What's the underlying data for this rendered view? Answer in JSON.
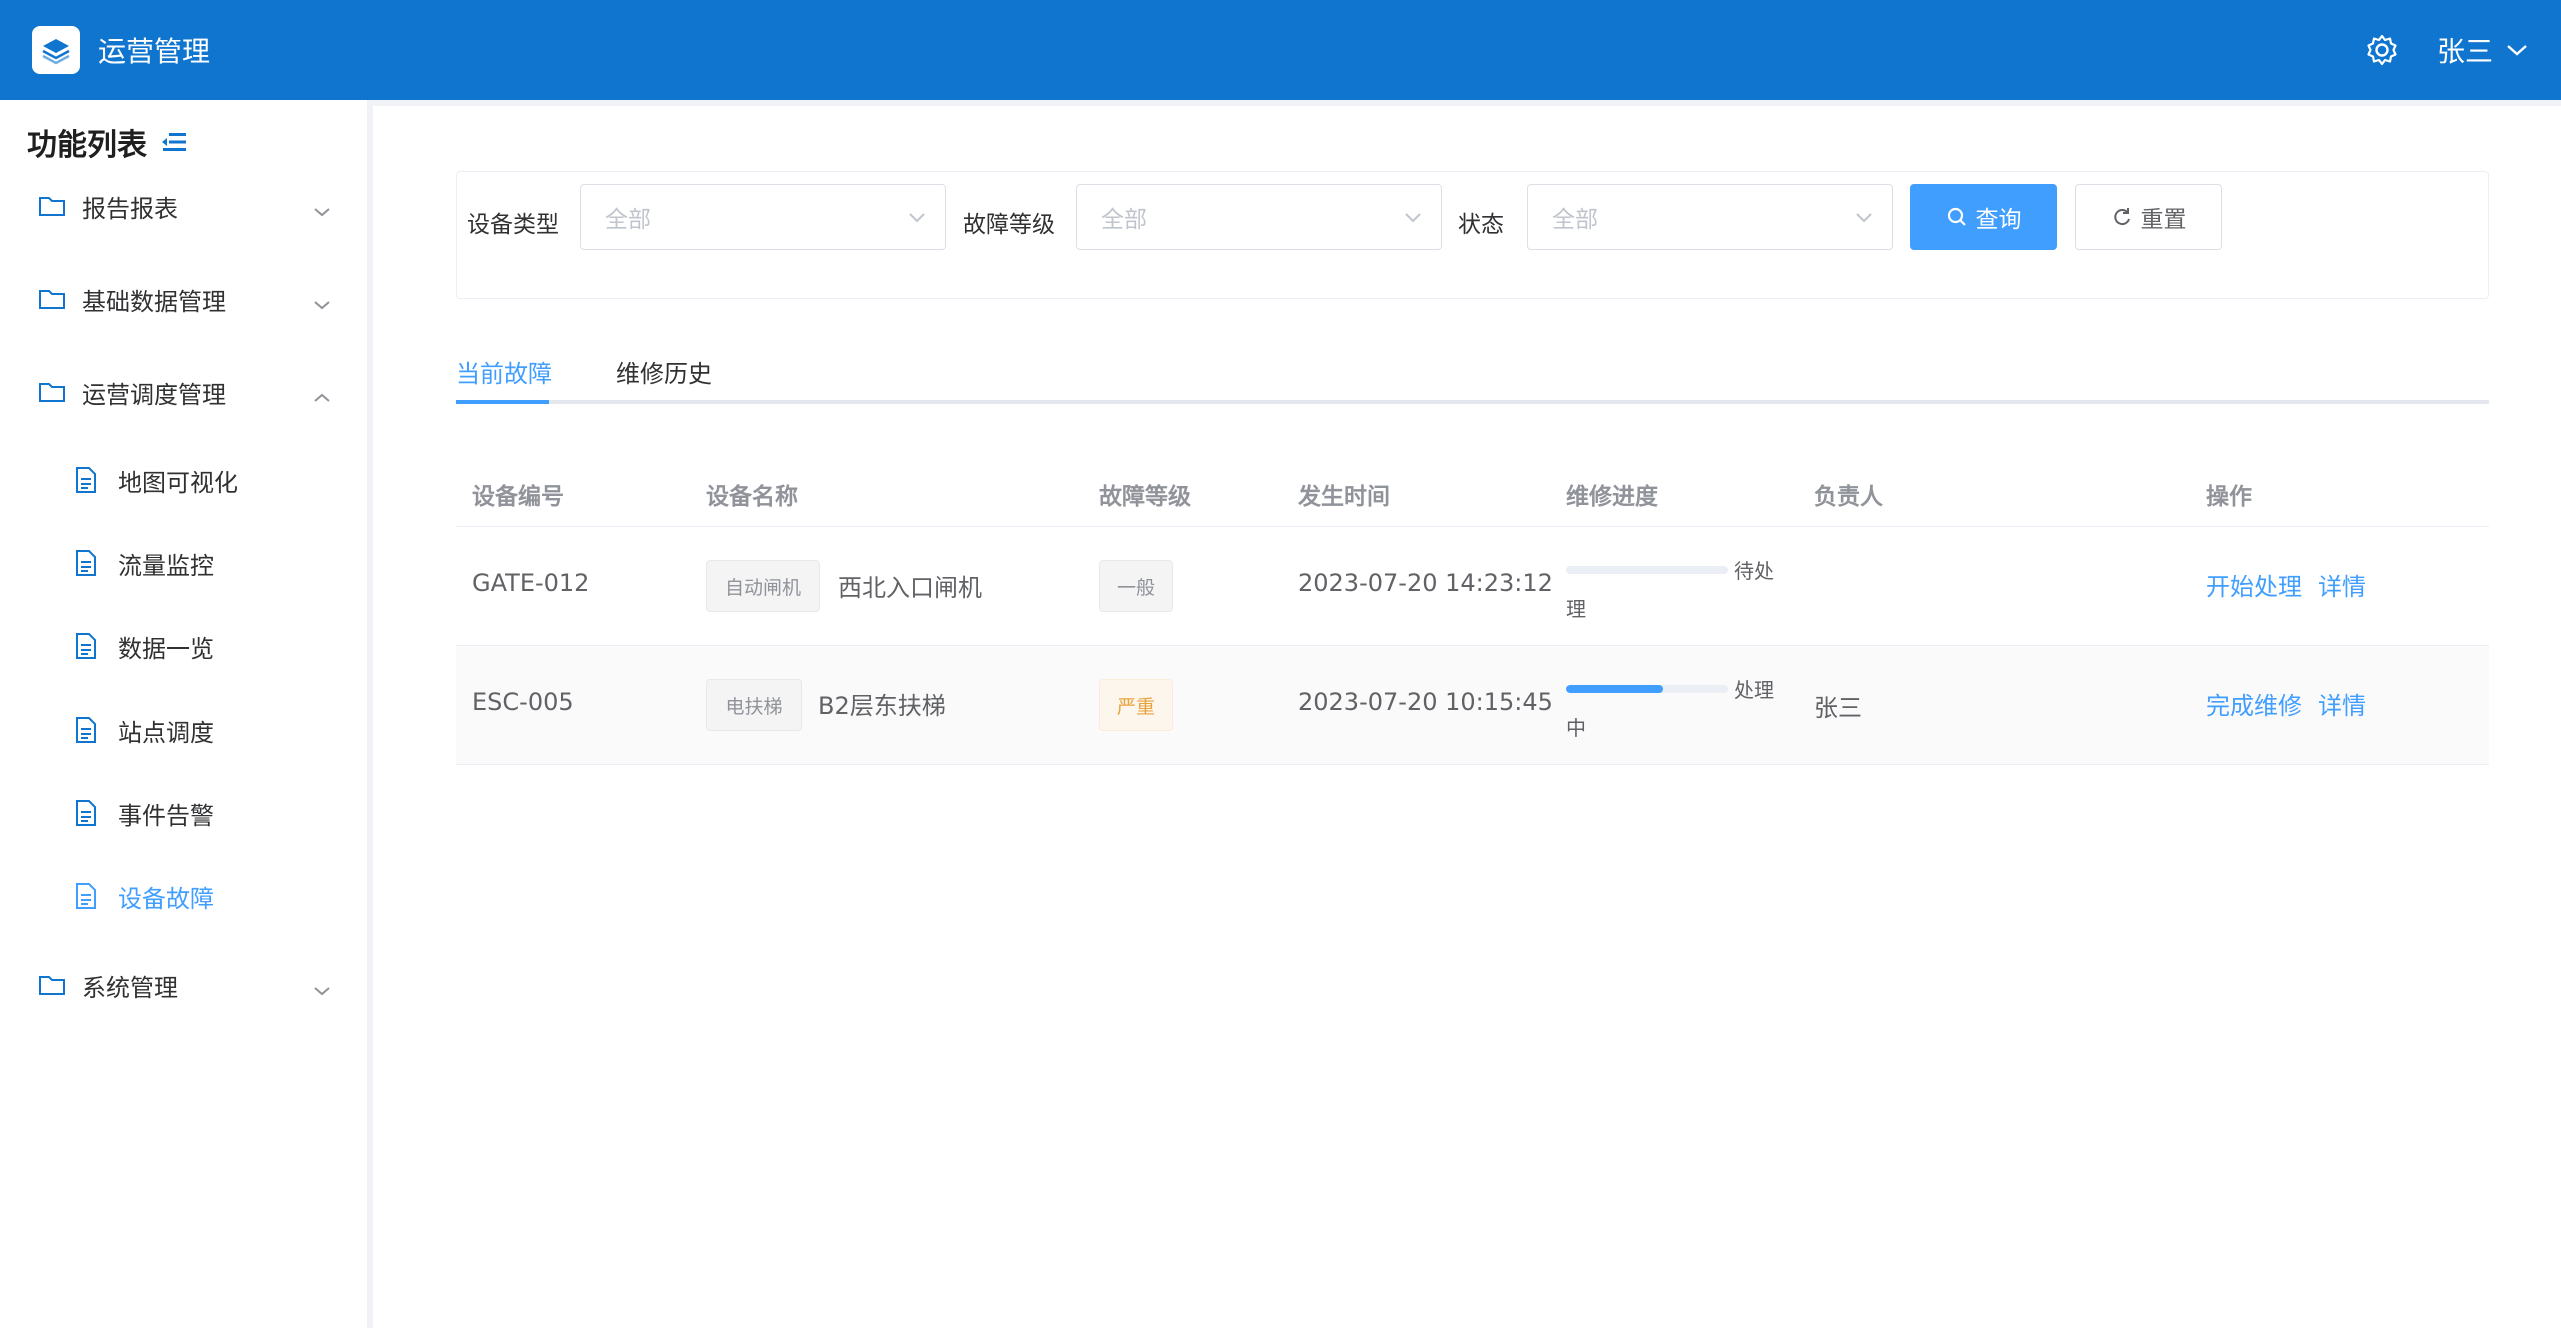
{
  "header": {
    "app_title": "运营管理",
    "user_name": "张三",
    "brand_color": "#0f75cf"
  },
  "sidebar": {
    "title": "功能列表",
    "items": [
      {
        "label": "报告报表",
        "icon": "folder-icon",
        "expanded": false
      },
      {
        "label": "基础数据管理",
        "icon": "folder-icon",
        "expanded": false
      },
      {
        "label": "运营调度管理",
        "icon": "folder-icon",
        "expanded": true,
        "children": [
          {
            "label": "地图可视化",
            "icon": "document-icon"
          },
          {
            "label": "流量监控",
            "icon": "document-icon"
          },
          {
            "label": "数据一览",
            "icon": "document-icon"
          },
          {
            "label": "站点调度",
            "icon": "document-icon"
          },
          {
            "label": "事件告警",
            "icon": "document-icon"
          },
          {
            "label": "设备故障",
            "icon": "document-icon",
            "active": true
          }
        ]
      },
      {
        "label": "系统管理",
        "icon": "folder-icon",
        "expanded": false
      }
    ]
  },
  "filters": {
    "device_type_label": "设备类型",
    "device_type_placeholder": "全部",
    "fault_level_label": "故障等级",
    "fault_level_placeholder": "全部",
    "status_label": "状态",
    "status_placeholder": "全部",
    "query_button": "查询",
    "reset_button": "重置"
  },
  "tabs": [
    {
      "label": "当前故障",
      "active": true
    },
    {
      "label": "维修历史",
      "active": false
    }
  ],
  "table": {
    "columns": [
      "设备编号",
      "设备名称",
      "故障等级",
      "发生时间",
      "维修进度",
      "负责人",
      "操作"
    ],
    "rows": [
      {
        "device_id": "GATE-012",
        "type_tag": "自动闸机",
        "name": "西北入口闸机",
        "level": "一般",
        "time": "2023-07-20 14:23:12",
        "progress": 0,
        "progress_text_1": "待处",
        "progress_text_2": "理",
        "owner": "",
        "action_primary": "开始处理",
        "action_detail": "详情"
      },
      {
        "device_id": "ESC-005",
        "type_tag": "电扶梯",
        "name": "B2层东扶梯",
        "level": "严重",
        "time": "2023-07-20 10:15:45",
        "progress": 60,
        "progress_text_1": "处理",
        "progress_text_2": "中",
        "owner": "张三",
        "action_primary": "完成维修",
        "action_detail": "详情"
      }
    ]
  },
  "accent_color": "#409eff"
}
